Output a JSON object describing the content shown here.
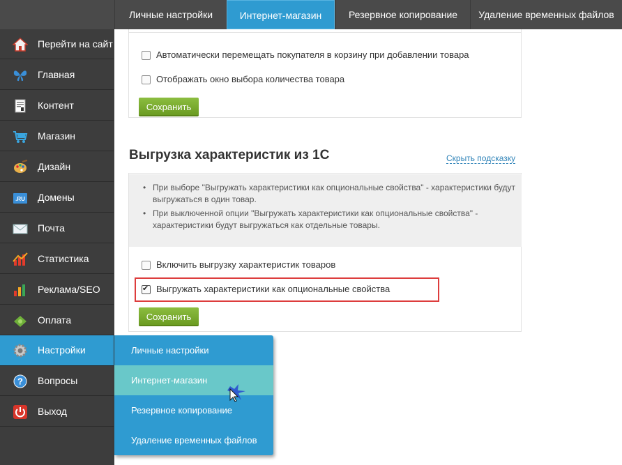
{
  "tabs": [
    {
      "label": "Личные настройки"
    },
    {
      "label": "Интернет-магазин",
      "active": true
    },
    {
      "label": "Резервное копирование"
    },
    {
      "label": "Удаление временных файлов"
    }
  ],
  "sidebar": {
    "items": [
      {
        "label": "Перейти на сайт",
        "icon": "home-icon"
      },
      {
        "label": "Главная",
        "icon": "butterfly-icon"
      },
      {
        "label": "Контент",
        "icon": "document-icon"
      },
      {
        "label": "Магазин",
        "icon": "cart-icon"
      },
      {
        "label": "Дизайн",
        "icon": "palette-icon"
      },
      {
        "label": "Домены",
        "icon": "ru-domain-icon"
      },
      {
        "label": "Почта",
        "icon": "envelope-icon"
      },
      {
        "label": "Статистика",
        "icon": "chart-icon"
      },
      {
        "label": "Реклама/SEO",
        "icon": "bar-chart-icon"
      },
      {
        "label": "Оплата",
        "icon": "payment-icon"
      },
      {
        "label": "Настройки",
        "icon": "gear-icon",
        "active": true
      },
      {
        "label": "Вопросы",
        "icon": "question-icon"
      },
      {
        "label": "Выход",
        "icon": "power-icon"
      }
    ]
  },
  "submenu": {
    "items": [
      {
        "label": "Личные настройки"
      },
      {
        "label": "Интернет-магазин",
        "hover": true
      },
      {
        "label": "Резервное копирование"
      },
      {
        "label": "Удаление временных файлов"
      }
    ]
  },
  "cart_section": {
    "option1": {
      "label": "Автоматически перемещать покупателя в корзину при добавлении товара",
      "checked": false
    },
    "option2": {
      "label": "Отображать окно выбора количества товара",
      "checked": false
    },
    "save_label": "Сохранить"
  },
  "export_section": {
    "title": "Выгрузка характеристик из 1С",
    "hide_hint_label": "Скрыть подсказку",
    "hints": [
      "При выборе \"Выгружать характеристики как опциональные свойства\" - характеристики будут выгружаться в один товар.",
      "При выключенной опции \"Выгружать характеристики как опциональные свойства\" - характеристики будут выгружаться как отдельные товары."
    ],
    "option1": {
      "label": "Включить выгрузку характеристик товаров",
      "checked": false
    },
    "option2": {
      "label": "Выгружать характеристики как опциональные свойства",
      "checked": true
    },
    "save_label": "Сохранить"
  },
  "colors": {
    "accent": "#2f9bd1",
    "submenu_hover": "#69c8c9",
    "button_green": "#7aab2d",
    "highlight_red": "#dd3d3d",
    "sidebar_bg": "#3d3d3d",
    "topbar_bg": "#4a4a4a"
  }
}
